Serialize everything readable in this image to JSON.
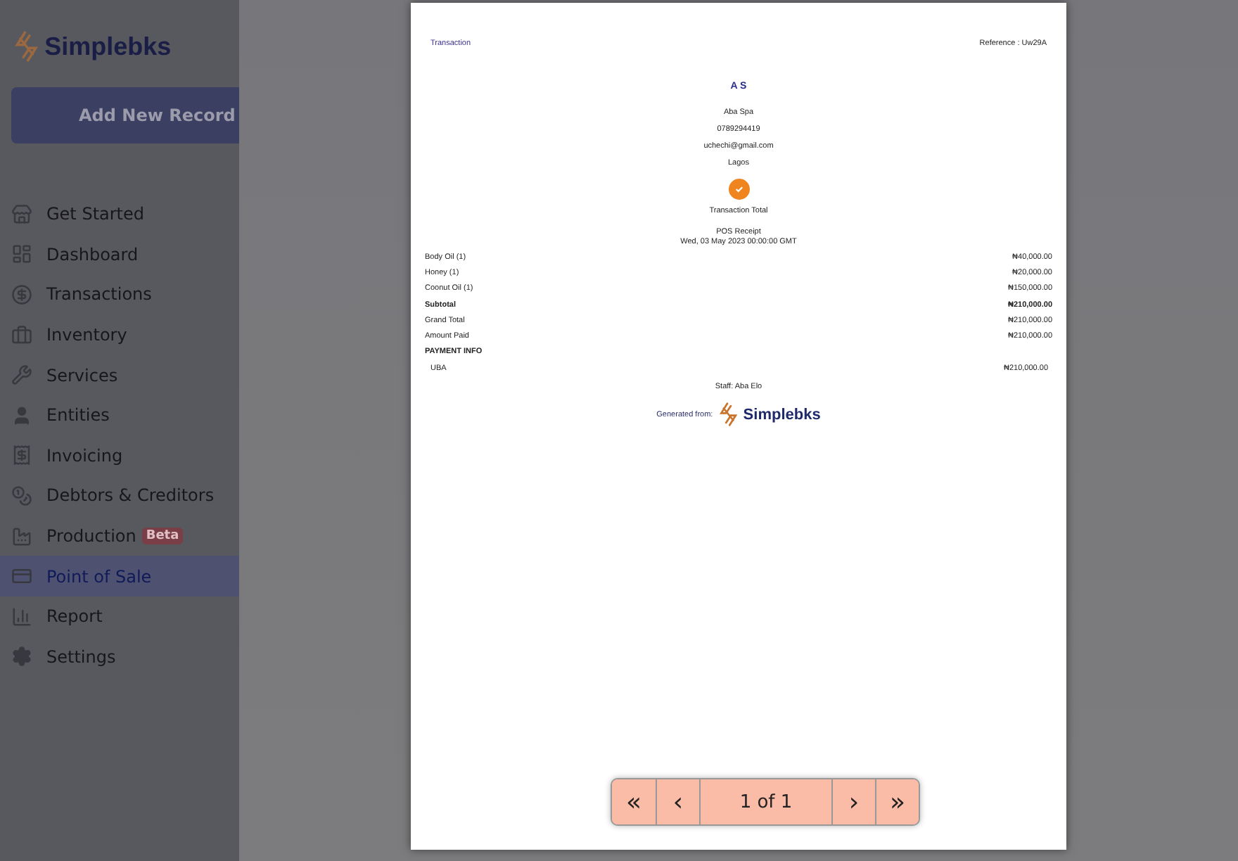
{
  "sidebar": {
    "brand": "Simplebks",
    "add_button": "Add New Record",
    "items": [
      {
        "kind": "store",
        "label": "Get Started",
        "selected": false
      },
      {
        "kind": "dashboard",
        "label": "Dashboard",
        "selected": false
      },
      {
        "kind": "transactions",
        "label": "Transactions",
        "selected": false
      },
      {
        "kind": "inventory",
        "label": "Inventory",
        "selected": false
      },
      {
        "kind": "services",
        "label": "Services",
        "selected": false
      },
      {
        "kind": "entities",
        "label": "Entities",
        "selected": false
      },
      {
        "kind": "invoicing",
        "label": "Invoicing",
        "selected": false
      },
      {
        "kind": "debtors",
        "label": "Debtors & Creditors",
        "selected": false
      },
      {
        "kind": "production",
        "label": "Production",
        "selected": false,
        "badge": "Beta"
      },
      {
        "kind": "pos",
        "label": "Point of Sale",
        "selected": true
      },
      {
        "kind": "report",
        "label": "Report",
        "selected": false
      },
      {
        "kind": "settings",
        "label": "Settings",
        "selected": false
      }
    ]
  },
  "receipt": {
    "title": "Transaction",
    "reference": "Reference : Uw29A",
    "business_initials": "A S",
    "business_name": "Aba Spa",
    "phone": "0789294419",
    "email": "uchechi@gmail.com",
    "city": "Lagos",
    "total_label": "Transaction Total",
    "receipt_type": "POS Receipt",
    "date": "Wed, 03 May 2023 00:00:00 GMT",
    "lines": [
      {
        "kind": "item",
        "label": "Body Oil (1)",
        "amount": "₦40,000.00"
      },
      {
        "kind": "item",
        "label": "Honey (1)",
        "amount": "₦20,000.00"
      },
      {
        "kind": "item",
        "label": "Coonut Oil (1)",
        "amount": "₦150,000.00"
      },
      {
        "kind": "total",
        "label": "Subtotal",
        "amount": "₦210,000.00"
      },
      {
        "kind": "item",
        "label": "Grand Total",
        "amount": "₦210,000.00"
      },
      {
        "kind": "item",
        "label": "Amount Paid",
        "amount": "₦210,000.00"
      }
    ],
    "payment_heading": "PAYMENT INFO",
    "payments": [
      {
        "method": "UBA",
        "amount": "₦210,000.00"
      }
    ],
    "staff": "Staff: Aba Elo",
    "generated_label": "Generated from:",
    "generated_brand": "Simplebks"
  },
  "pager": {
    "first": "«",
    "prev": "‹",
    "page": "1 of 1",
    "next": "›",
    "last": "»"
  }
}
